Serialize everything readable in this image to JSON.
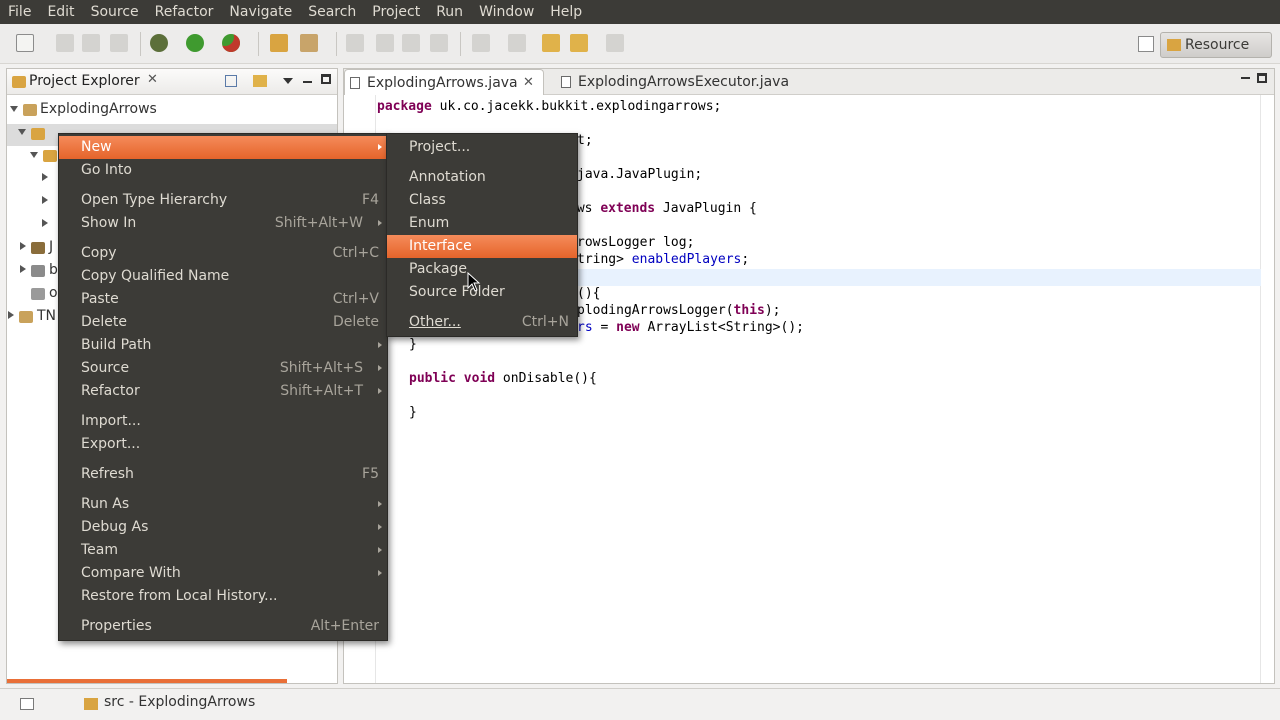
{
  "menubar": {
    "items": [
      "File",
      "Edit",
      "Source",
      "Refactor",
      "Navigate",
      "Search",
      "Project",
      "Run",
      "Window",
      "Help"
    ]
  },
  "toolbar": {
    "perspective_label": "Resource"
  },
  "explorer": {
    "tab_title": "Project Explorer",
    "project_root": "ExplodingArrows",
    "partial_items": [
      "J",
      "b",
      "o",
      "TN"
    ]
  },
  "editor": {
    "tabs": [
      "ExplodingArrows.java",
      "ExplodingArrowsExecutor.java"
    ],
    "code_lines": [
      {
        "kw": "package",
        "text": " uk.co.jacekk.bukkit.explodingarrows;"
      },
      {
        "text": "t;"
      },
      {
        "text": "java.JavaPlugin;"
      },
      {
        "text": "ows ",
        "kw": "extends",
        "tail": " JavaPlugin {"
      },
      {
        "text": "rowsLogger log;"
      },
      {
        "text": "tring> ",
        "field": "enabledPlayers",
        "tail": ";"
      },
      {
        "text": "(){"
      },
      {
        "text": "plodingArrowsLogger(",
        "kw": "this",
        "tail": ");"
      },
      {
        "field": "rs",
        "text": " = ",
        "kw": "new",
        "tail": " ArrayList<String>();"
      },
      {
        "text": "}"
      },
      {
        "kw": "public void",
        "text": " onDisable(){"
      },
      {
        "text": "}"
      }
    ]
  },
  "context_menu": {
    "items": [
      {
        "label": "New",
        "accel": "",
        "submenu": true
      },
      {
        "label": "Go Into",
        "accel": ""
      },
      {
        "label": "Open Type Hierarchy",
        "accel": "F4"
      },
      {
        "label": "Show In",
        "accel": "Shift+Alt+W",
        "submenu": true
      },
      {
        "label": "Copy",
        "accel": "Ctrl+C"
      },
      {
        "label": "Copy Qualified Name",
        "accel": ""
      },
      {
        "label": "Paste",
        "accel": "Ctrl+V"
      },
      {
        "label": "Delete",
        "accel": "Delete"
      },
      {
        "label": "Build Path",
        "accel": "",
        "submenu": true
      },
      {
        "label": "Source",
        "accel": "Shift+Alt+S",
        "submenu": true
      },
      {
        "label": "Refactor",
        "accel": "Shift+Alt+T",
        "submenu": true
      },
      {
        "label": "Import...",
        "accel": ""
      },
      {
        "label": "Export...",
        "accel": ""
      },
      {
        "label": "Refresh",
        "accel": "F5"
      },
      {
        "label": "Run As",
        "accel": "",
        "submenu": true
      },
      {
        "label": "Debug As",
        "accel": "",
        "submenu": true
      },
      {
        "label": "Team",
        "accel": "",
        "submenu": true
      },
      {
        "label": "Compare With",
        "accel": "",
        "submenu": true
      },
      {
        "label": "Restore from Local History...",
        "accel": ""
      },
      {
        "label": "Properties",
        "accel": "Alt+Enter"
      }
    ]
  },
  "submenu": {
    "items": [
      {
        "label": "Project...",
        "accel": ""
      },
      {
        "label": "Annotation",
        "accel": ""
      },
      {
        "label": "Class",
        "accel": ""
      },
      {
        "label": "Enum",
        "accel": ""
      },
      {
        "label": "Interface",
        "accel": "",
        "highlighted": true
      },
      {
        "label": "Package",
        "accel": ""
      },
      {
        "label": "Source Folder",
        "accel": ""
      },
      {
        "label": "Other...",
        "accel": "Ctrl+N"
      }
    ]
  },
  "statusbar": {
    "selection": "src - ExplodingArrows"
  },
  "colors": {
    "menu_bg": "#3c3b37",
    "menu_highlight": "#e96f37",
    "keyword": "#7f0055",
    "field": "#0000c0"
  }
}
